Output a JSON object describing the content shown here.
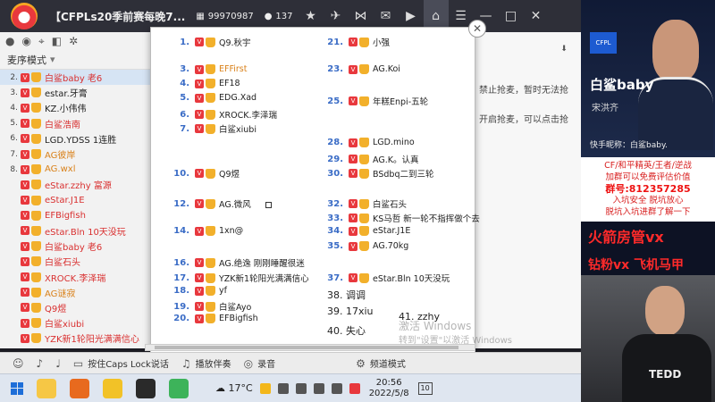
{
  "topbar": {
    "title": "【CFPLs20季前赛每晚7...",
    "room_id": "99970987",
    "viewers": "137"
  },
  "left_panel": {
    "mic_mode": "麦序模式",
    "rows": [
      {
        "num": "2.",
        "name": "白鲨baby 老6",
        "style": "red",
        "active": true
      },
      {
        "num": "3.",
        "name": "estar.牙膏",
        "style": ""
      },
      {
        "num": "4.",
        "name": "KZ.小伟伟",
        "style": ""
      },
      {
        "num": "5.",
        "name": "白鲨浩南",
        "style": "red"
      },
      {
        "num": "6.",
        "name": "LGD.YDSS 1连胜",
        "style": ""
      },
      {
        "num": "7.",
        "name": "AG彼岸",
        "style": "orange"
      },
      {
        "num": "8.",
        "name": "AG.wxl",
        "style": "orange"
      },
      {
        "num": "",
        "name": "eStar.zzhy 富源",
        "style": "red"
      },
      {
        "num": "",
        "name": "eStar.J1E",
        "style": "red"
      },
      {
        "num": "",
        "name": "EFBigfish",
        "style": "red"
      },
      {
        "num": "",
        "name": "eStar.Bln 10天没玩",
        "style": "red"
      },
      {
        "num": "",
        "name": "白鲨baby 老6",
        "style": "red"
      },
      {
        "num": "",
        "name": "白鲨石头",
        "style": "red"
      },
      {
        "num": "",
        "name": "XROCK.李泽瑞",
        "style": "red"
      },
      {
        "num": "",
        "name": "AG谜寂",
        "style": "orange"
      },
      {
        "num": "",
        "name": "Q9煜",
        "style": "red"
      },
      {
        "num": "",
        "name": "白鲨xiubi",
        "style": "red"
      },
      {
        "num": "",
        "name": "YZK新1轮阳光满满信心",
        "style": "red"
      }
    ]
  },
  "chat": {
    "lines": [
      "禁止抢麦，暂时无法抢",
      "开启抢麦，可以点击抢"
    ]
  },
  "popup": {
    "entries": [
      {
        "num": "1.",
        "name": "Q9.秋宇",
        "style": ""
      },
      {
        "num": "3.",
        "name": "EFFirst",
        "style": "orange"
      },
      {
        "num": "4.",
        "name": "EF18",
        "style": ""
      },
      {
        "num": "5.",
        "name": "EDG.Xad",
        "style": ""
      },
      {
        "num": "6.",
        "name": "XROCK.李泽瑞",
        "style": ""
      },
      {
        "num": "7.",
        "name": "白鲨xiubi",
        "style": ""
      },
      {
        "num": "10.",
        "name": "Q9煜",
        "style": ""
      },
      {
        "num": "12.",
        "name": "AG.微风",
        "style": ""
      },
      {
        "num": "14.",
        "name": "1xn@",
        "style": ""
      },
      {
        "num": "16.",
        "name": "AG.绝逸 刚刚睡醒很迷",
        "style": ""
      },
      {
        "num": "17.",
        "name": "YZK新1轮阳光满满信心",
        "style": ""
      },
      {
        "num": "18.",
        "name": "yf",
        "style": ""
      },
      {
        "num": "19.",
        "name": "白鲨Ayo",
        "style": ""
      },
      {
        "num": "20.",
        "name": "EFBigfish",
        "style": ""
      },
      {
        "num": "21.",
        "name": "小强",
        "style": ""
      },
      {
        "num": "23.",
        "name": "AG.Koi",
        "style": ""
      },
      {
        "num": "25.",
        "name": "年糕Enpi-五轮",
        "style": ""
      },
      {
        "num": "28.",
        "name": "LGD.mino",
        "style": ""
      },
      {
        "num": "29.",
        "name": "AG.K。认真",
        "style": ""
      },
      {
        "num": "30.",
        "name": "BSdbq二到三轮",
        "style": ""
      },
      {
        "num": "32.",
        "name": "白鲨石头",
        "style": ""
      },
      {
        "num": "33.",
        "name": "KS马哲 新一轮不指挥做个去",
        "style": ""
      },
      {
        "num": "34.",
        "name": "eStar.J1E",
        "style": ""
      },
      {
        "num": "35.",
        "name": "AG.70kg",
        "style": ""
      },
      {
        "num": "37.",
        "name": "eStar.Bln 10天没玩",
        "style": ""
      },
      {
        "num": "",
        "name": "38. 调调",
        "style": "plain"
      },
      {
        "num": "",
        "name": "39. 17xiu",
        "style": "plain"
      },
      {
        "num": "",
        "name": "40. 失心",
        "style": "plain"
      },
      {
        "num": "",
        "name": "41. zzhy",
        "style": "plain"
      }
    ]
  },
  "watermark": {
    "line1": "激活 Windows",
    "line2": "转到\"设置\"以激活 Windows"
  },
  "bottombar": {
    "caps_label": "按住Caps Lock说话",
    "music_label": "播放伴奏",
    "record_label": "录音",
    "settings_label": "频道模式"
  },
  "stream": {
    "streamer_name": "白鲨baby",
    "real_name": "宋洪齐",
    "kuaishou": "快手昵称：白鲨baby.",
    "badge": "CFPL",
    "promo": [
      "CF/和平精英/王者/逆战",
      "加群可以免费评估价值",
      "群号:812357285",
      "入坑安全  脱坑放心",
      "脱坑入坑进群了解一下"
    ],
    "room_manager": "火箭房管vx",
    "fans": "钻粉vx 飞机马甲",
    "shirt": "TEDD"
  },
  "taskbar": {
    "weather": "17°C",
    "time": "20:56",
    "date": "2022/5/8",
    "notifications": "10"
  }
}
